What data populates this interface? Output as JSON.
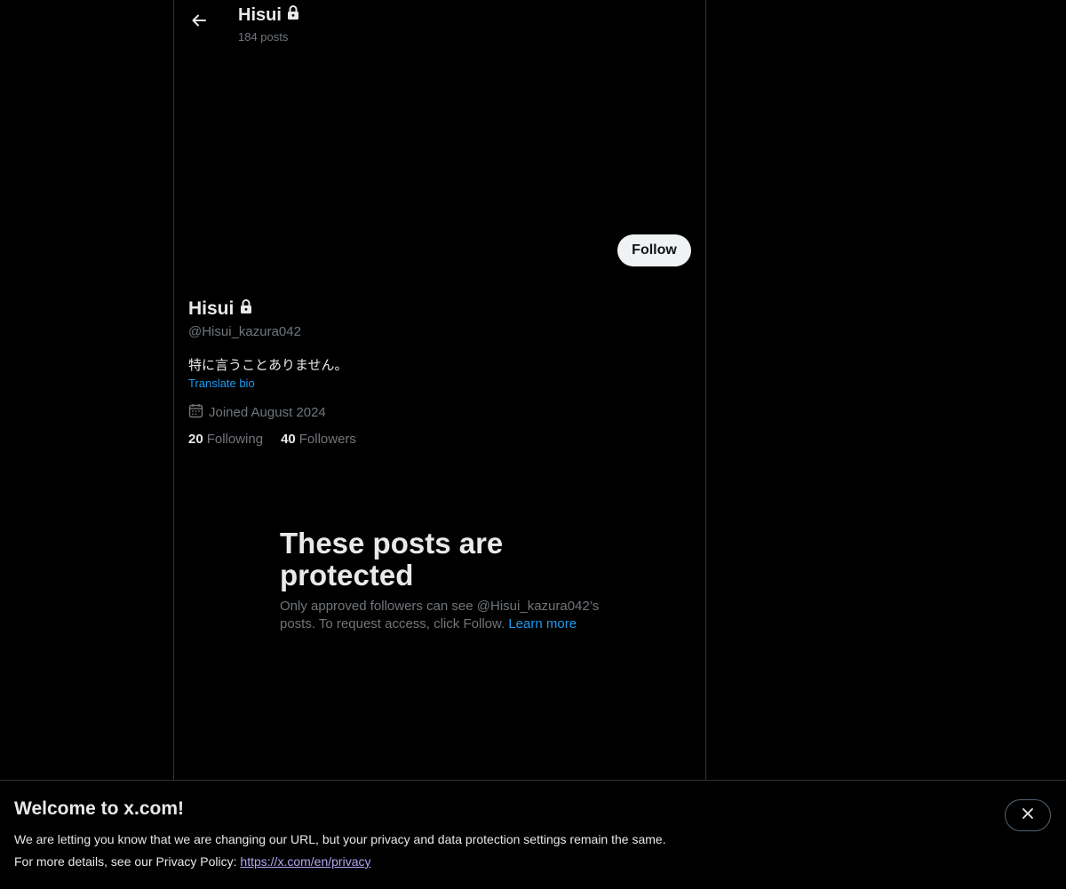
{
  "header": {
    "title": "Hisui",
    "posts_count": "184 posts",
    "back_icon": "arrow-left-icon"
  },
  "profile": {
    "name": "Hisui",
    "handle": "@Hisui_kazura042",
    "bio": "特に言うことありません。",
    "translate_label": "Translate bio",
    "joined": "Joined August 2024",
    "following_count": "20",
    "following_label": "Following",
    "followers_count": "40",
    "followers_label": "Followers",
    "follow_label": "Follow",
    "lock_icon": "lock-icon",
    "calendar_icon": "calendar-icon"
  },
  "protected": {
    "title": "These posts are protected",
    "text": "Only approved followers can see @Hisui_kazura042’s posts. To request access, click Follow. ",
    "learn_more": "Learn more"
  },
  "banner": {
    "title": "Welcome to x.com!",
    "line1": "We are letting you know that we are changing our URL, but your privacy and data protection settings remain the same.",
    "line2_prefix": "For more details, see our Privacy Policy: ",
    "privacy_link": "https://x.com/en/privacy",
    "close_icon": "close-icon"
  },
  "colors": {
    "background": "#000000",
    "text_primary": "#e7e9ea",
    "text_secondary": "#71767b",
    "accent": "#1d9bf0",
    "border": "#2f3336",
    "link_visited": "#b4a7f5"
  }
}
